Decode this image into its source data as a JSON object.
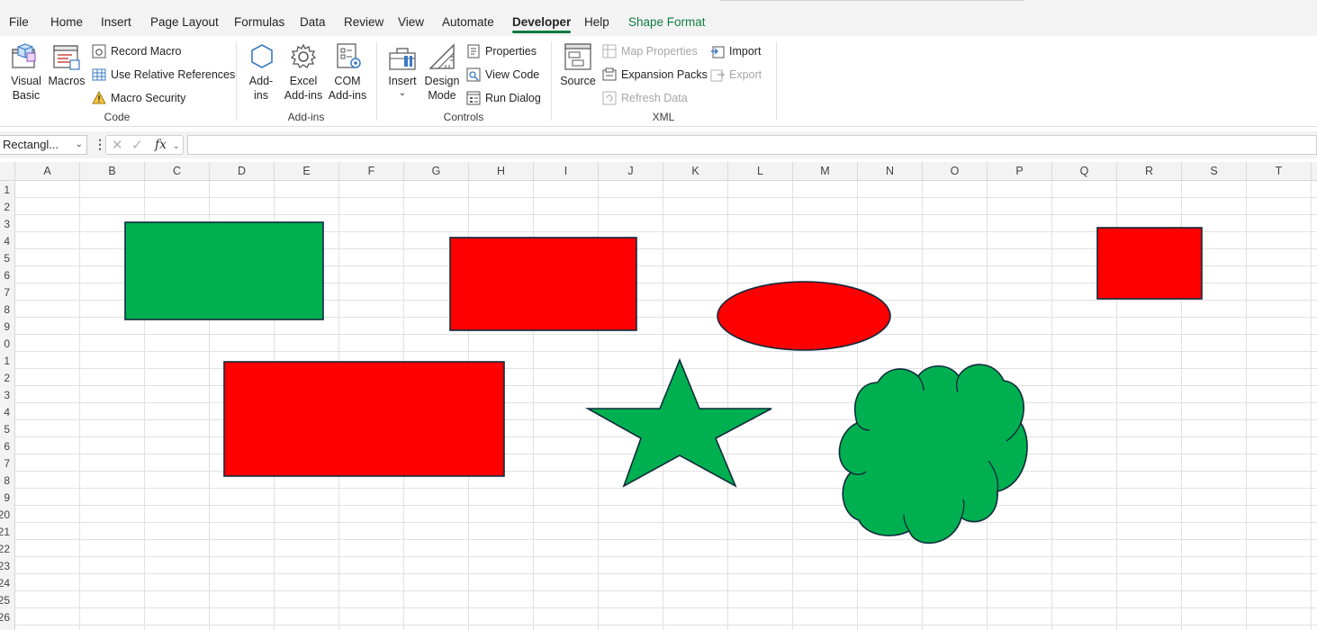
{
  "ribbon_tabs": [
    "File",
    "Home",
    "Insert",
    "Page Layout",
    "Formulas",
    "Data",
    "Review",
    "View",
    "Automate",
    "Developer",
    "Help",
    "Shape Format"
  ],
  "active_tab": "Developer",
  "code_group": {
    "visual_basic": [
      "Visual",
      "Basic"
    ],
    "macros": "Macros",
    "record_macro": "Record Macro",
    "use_relative_references": "Use Relative References",
    "macro_security": "Macro Security",
    "label": "Code"
  },
  "addins_group": {
    "addins": [
      "Add-",
      "ins"
    ],
    "excel_addins": [
      "Excel",
      "Add-ins"
    ],
    "com_addins": [
      "COM",
      "Add-ins"
    ],
    "label": "Add-ins"
  },
  "controls_group": {
    "insert": "Insert",
    "design_mode": [
      "Design",
      "Mode"
    ],
    "properties": "Properties",
    "view_code": "View Code",
    "run_dialog": "Run Dialog",
    "label": "Controls"
  },
  "xml_group": {
    "source": "Source",
    "map_properties": "Map Properties",
    "expansion_packs": "Expansion Packs",
    "refresh_data": "Refresh Data",
    "import": "Import",
    "export": "Export",
    "label": "XML"
  },
  "formula_bar": {
    "name_box": "Rectangl...",
    "fx_label": "fx",
    "formula": ""
  },
  "columns": [
    "A",
    "B",
    "C",
    "D",
    "E",
    "F",
    "G",
    "H",
    "I",
    "J",
    "K",
    "L",
    "M",
    "N",
    "O",
    "P",
    "Q",
    "R",
    "S",
    "T"
  ],
  "row_labels": [
    "1",
    "2",
    "3",
    "4",
    "5",
    "6",
    "7",
    "8",
    "9",
    "0",
    "1",
    "2",
    "3",
    "4",
    "5",
    "6",
    "7",
    "8",
    "9",
    "20",
    "21",
    "22",
    "23",
    "24",
    "25",
    "26"
  ],
  "shapes": [
    {
      "name": "green-rectangle",
      "type": "rectangle",
      "fill": "#00b050"
    },
    {
      "name": "red-rectangle-1",
      "type": "rectangle",
      "fill": "#ff0000"
    },
    {
      "name": "red-ellipse",
      "type": "oval",
      "fill": "#ff0000"
    },
    {
      "name": "red-rectangle-2",
      "type": "rectangle",
      "fill": "#ff0000"
    },
    {
      "name": "red-rectangle-3",
      "type": "rectangle",
      "fill": "#ff0000"
    },
    {
      "name": "green-star",
      "type": "star",
      "fill": "#00b050"
    },
    {
      "name": "green-cloud",
      "type": "cloud",
      "fill": "#00b050"
    }
  ],
  "colors": {
    "shape_outline": "#0f2b3c",
    "accent": "#107c41",
    "gridline": "#e1e1e1"
  }
}
